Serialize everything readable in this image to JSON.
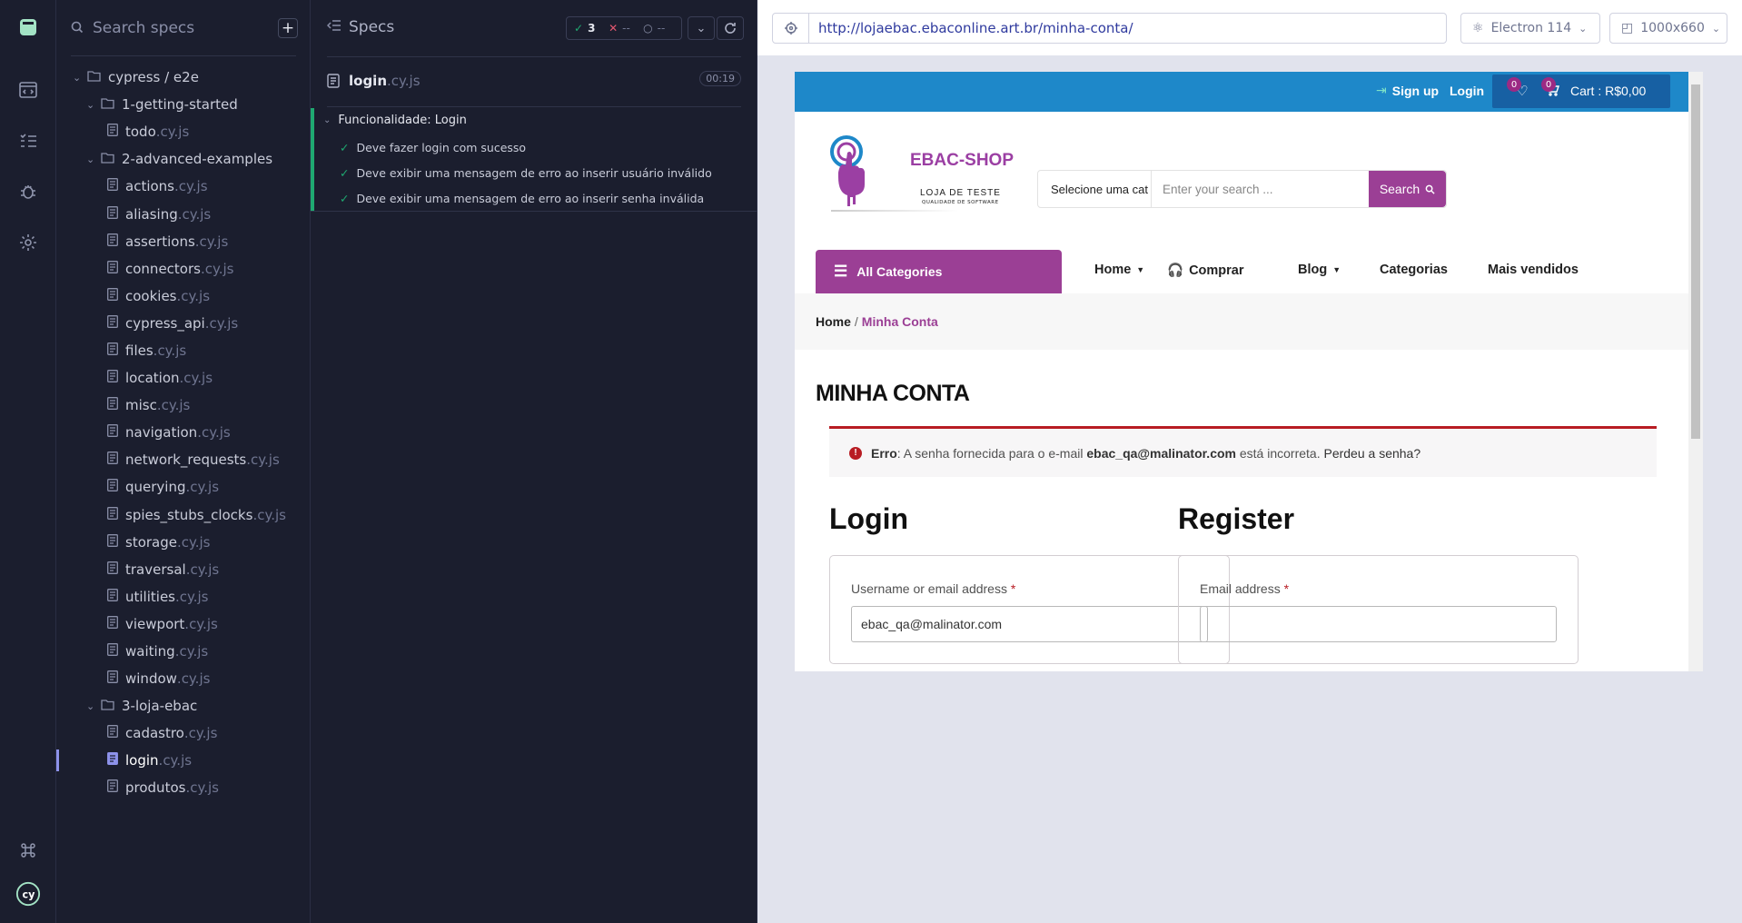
{
  "sidebar": {
    "search_placeholder": "Search specs",
    "add_label": "+",
    "tree": [
      {
        "kind": "folder",
        "level": 0,
        "label": "cypress / e2e"
      },
      {
        "kind": "folder",
        "level": 1,
        "label": "1-getting-started"
      },
      {
        "kind": "file",
        "level": 2,
        "name": "todo",
        "ext": ".cy.js"
      },
      {
        "kind": "folder",
        "level": 1,
        "label": "2-advanced-examples"
      },
      {
        "kind": "file",
        "level": 2,
        "name": "actions",
        "ext": ".cy.js"
      },
      {
        "kind": "file",
        "level": 2,
        "name": "aliasing",
        "ext": ".cy.js"
      },
      {
        "kind": "file",
        "level": 2,
        "name": "assertions",
        "ext": ".cy.js"
      },
      {
        "kind": "file",
        "level": 2,
        "name": "connectors",
        "ext": ".cy.js"
      },
      {
        "kind": "file",
        "level": 2,
        "name": "cookies",
        "ext": ".cy.js"
      },
      {
        "kind": "file",
        "level": 2,
        "name": "cypress_api",
        "ext": ".cy.js"
      },
      {
        "kind": "file",
        "level": 2,
        "name": "files",
        "ext": ".cy.js"
      },
      {
        "kind": "file",
        "level": 2,
        "name": "location",
        "ext": ".cy.js"
      },
      {
        "kind": "file",
        "level": 2,
        "name": "misc",
        "ext": ".cy.js"
      },
      {
        "kind": "file",
        "level": 2,
        "name": "navigation",
        "ext": ".cy.js"
      },
      {
        "kind": "file",
        "level": 2,
        "name": "network_requests",
        "ext": ".cy.js"
      },
      {
        "kind": "file",
        "level": 2,
        "name": "querying",
        "ext": ".cy.js"
      },
      {
        "kind": "file",
        "level": 2,
        "name": "spies_stubs_clocks",
        "ext": ".cy.js"
      },
      {
        "kind": "file",
        "level": 2,
        "name": "storage",
        "ext": ".cy.js"
      },
      {
        "kind": "file",
        "level": 2,
        "name": "traversal",
        "ext": ".cy.js"
      },
      {
        "kind": "file",
        "level": 2,
        "name": "utilities",
        "ext": ".cy.js"
      },
      {
        "kind": "file",
        "level": 2,
        "name": "viewport",
        "ext": ".cy.js"
      },
      {
        "kind": "file",
        "level": 2,
        "name": "waiting",
        "ext": ".cy.js"
      },
      {
        "kind": "file",
        "level": 2,
        "name": "window",
        "ext": ".cy.js"
      },
      {
        "kind": "folder",
        "level": 1,
        "label": "3-loja-ebac"
      },
      {
        "kind": "file",
        "level": 2,
        "name": "cadastro",
        "ext": ".cy.js"
      },
      {
        "kind": "file",
        "level": 2,
        "name": "login",
        "ext": ".cy.js",
        "active": true
      },
      {
        "kind": "file",
        "level": 2,
        "name": "produtos",
        "ext": ".cy.js"
      }
    ]
  },
  "reporter": {
    "title": "Specs",
    "passed": "3",
    "failed": "--",
    "pending": "--",
    "spec_name": "login",
    "spec_ext": ".cy.js",
    "duration": "00:19",
    "suite": "Funcionalidade: Login",
    "tests": [
      "Deve fazer login com sucesso",
      "Deve exibir uma mensagem de erro ao inserir usuário inválido",
      "Deve exibir uma mensagem de erro ao inserir senha inválida"
    ]
  },
  "aut_bar": {
    "url": "http://lojaebac.ebaconline.art.br/minha-conta/",
    "browser": "Electron 114",
    "viewport": "1000x660"
  },
  "site": {
    "signup": "Sign up",
    "login": "Login",
    "wishlist_count": "0",
    "cart_count": "0",
    "cart_label": "Cart : R$0,00",
    "logo_title": "EBAC-SHOP",
    "logo_sub": "LOJA DE TESTE",
    "logo_sub2": "QUALIDADE DE SOFTWARE",
    "search_category": "Selecione uma cat",
    "search_placeholder": "Enter your search ...",
    "search_button": "Search",
    "all_categories": "All Categories",
    "menu": {
      "home": "Home",
      "comprar": "Comprar",
      "blog": "Blog",
      "categorias": "Categorias",
      "mais_vendidos": "Mais vendidos"
    },
    "breadcrumb_home": "Home",
    "breadcrumb_sep": "/",
    "breadcrumb_current": "Minha Conta",
    "page_title": "MINHA CONTA",
    "error": {
      "label": "Erro",
      "text1": ": A senha fornecida para o e-mail ",
      "email": "ebac_qa@malinator.com",
      "text2": " está incorreta. ",
      "link": "Perdeu a senha?"
    },
    "login_title": "Login",
    "register_title": "Register",
    "username_label": "Username or email address",
    "username_value": "ebac_qa@malinator.com",
    "email_label": "Email address",
    "required": "*"
  },
  "colors": {
    "sidebar_bg": "#1b1e2e",
    "pass": "#1fa971",
    "fail": "#e45770",
    "site_blue": "#1e88c9",
    "site_purple": "#9b3f95",
    "error_red": "#b81c23"
  }
}
